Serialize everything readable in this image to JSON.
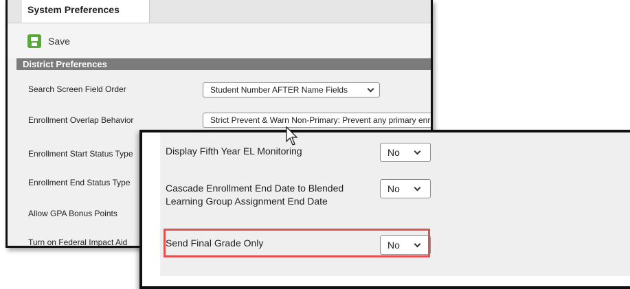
{
  "tab": {
    "title": "System Preferences"
  },
  "toolbar": {
    "save_label": "Save"
  },
  "district": {
    "section_title": "District Preferences",
    "rows": [
      {
        "label": "Search Screen Field Order",
        "value": "Student Number AFTER Name Fields"
      },
      {
        "label": "Enrollment Overlap Behavior",
        "value": "Strict Prevent & Warn Non-Primary: Prevent any primary enrollment in any calendar"
      },
      {
        "label": "Enrollment Start Status Type"
      },
      {
        "label": "Enrollment End Status Type"
      },
      {
        "label": "Allow GPA Bonus Points"
      },
      {
        "label": "Turn on Federal Impact Aid"
      }
    ]
  },
  "zoom": {
    "rows": [
      {
        "label": "Display Fifth Year EL Monitoring",
        "value": "No"
      },
      {
        "label": "Cascade Enrollment End Date to Blended Learning Group Assignment End Date",
        "value": "No"
      },
      {
        "label": "Send Final Grade Only",
        "value": "No"
      }
    ]
  },
  "colors": {
    "section_bar": "#7b7b7b",
    "save_icon": "#5aa83a",
    "highlight": "#e05252"
  }
}
